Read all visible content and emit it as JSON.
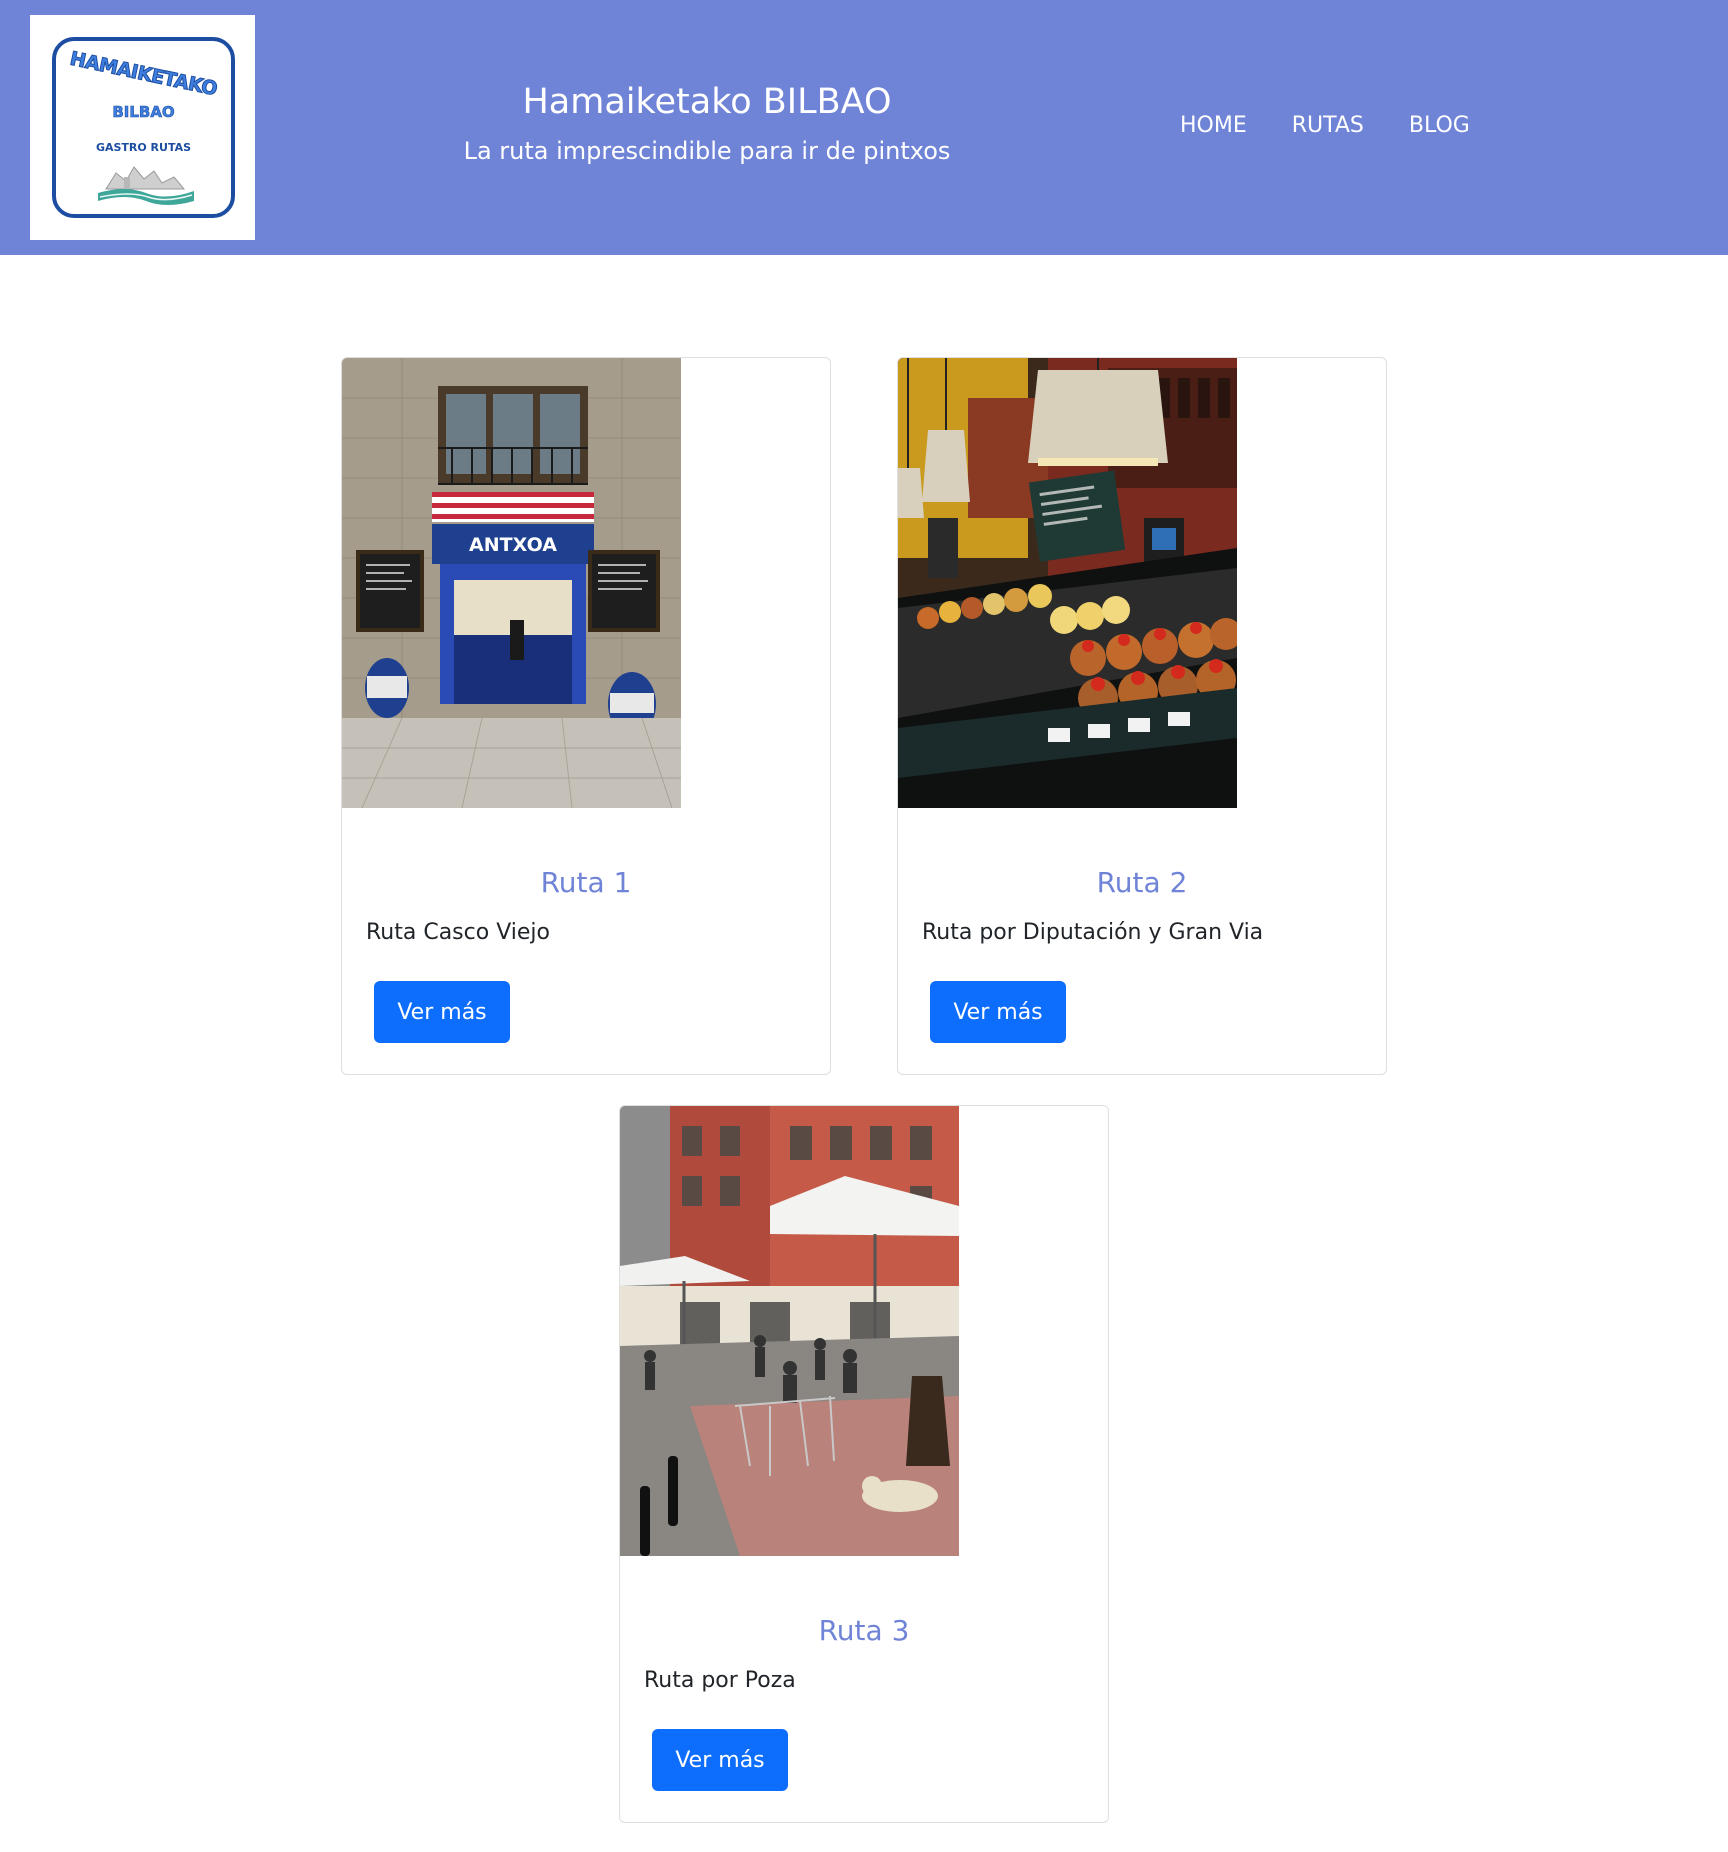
{
  "header": {
    "logo": {
      "line1": "HAMAIKETAKO",
      "line2": "BILBAO",
      "line3": "GASTRO RUTAS"
    },
    "title": "Hamaiketako BILBAO",
    "subtitle": "La ruta imprescindible para ir de pintxos",
    "nav": [
      "HOME",
      "RUTAS",
      "BLOG"
    ]
  },
  "cards": [
    {
      "title": "Ruta 1",
      "text": "Ruta Casco Viejo",
      "button": "Ver más",
      "image": "antxoa-taberna-storefront-photo"
    },
    {
      "title": "Ruta 2",
      "text": "Ruta por Diputación y Gran Via",
      "button": "Ver más",
      "image": "pintxos-bar-counter-photo"
    },
    {
      "title": "Ruta 3",
      "text": "Ruta por Poza",
      "button": "Ver más",
      "image": "street-terrace-umbrellas-photo"
    }
  ],
  "colors": {
    "header_bg": "#7084d7",
    "card_title": "#7084d7",
    "button_bg": "#0d6efd"
  }
}
